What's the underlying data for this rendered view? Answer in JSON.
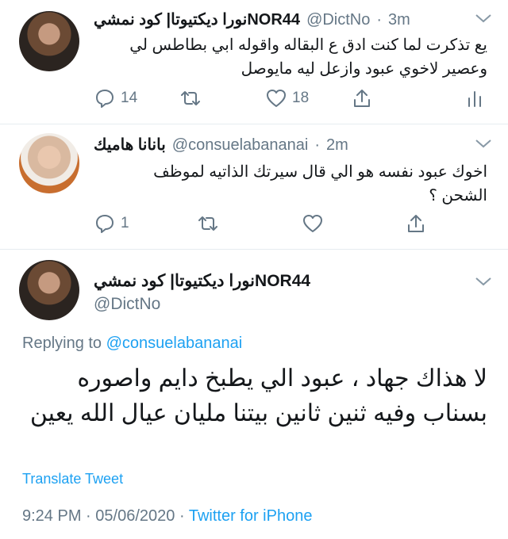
{
  "tweet1": {
    "display_name": "نورا ديكتيوتا| كود نمشيNOR44",
    "handle": "@DictNo",
    "time": "3m",
    "text_line1": "يع تذكرت لما كنت ادق ع البقاله واقوله ابي بطاطس لي",
    "text_line2": "وعصير لاخوي عبود وازعل ليه مايوصل",
    "reply_count": "14",
    "like_count": "18"
  },
  "tweet2": {
    "display_name": "بانانا هاميك",
    "handle": "@consuelabananai",
    "time": "2m",
    "text_line1": "اخوك عبود نفسه هو الي قال سيرتك الذاتيه لموظف",
    "text_line2": "الشحن ؟",
    "reply_count": "1"
  },
  "main_tweet": {
    "display_name": "نورا ديكتيوتا| كود نمشيNOR44",
    "handle": "@DictNo",
    "replying_prefix": "Replying to",
    "replying_to": "@consuelabananai",
    "text_line1": "لا هذاك جهاد ، عبود الي يطبخ دايم واصوره",
    "text_line2": "بسناب وفيه ثنين ثانين بيتنا مليان عيال الله يعين",
    "translate_label": "Translate Tweet",
    "time": "9:24 PM",
    "date": "05/06/2020",
    "source": "Twitter for iPhone",
    "separator": "·"
  },
  "icons": {
    "reply": "reply-icon",
    "retweet": "retweet-icon",
    "like": "heart-icon",
    "share": "share-icon",
    "analytics": "analytics-icon",
    "more": "chevron-down-icon"
  },
  "colors": {
    "link": "#1da1f2",
    "secondary": "#657786",
    "text": "#14171a"
  }
}
